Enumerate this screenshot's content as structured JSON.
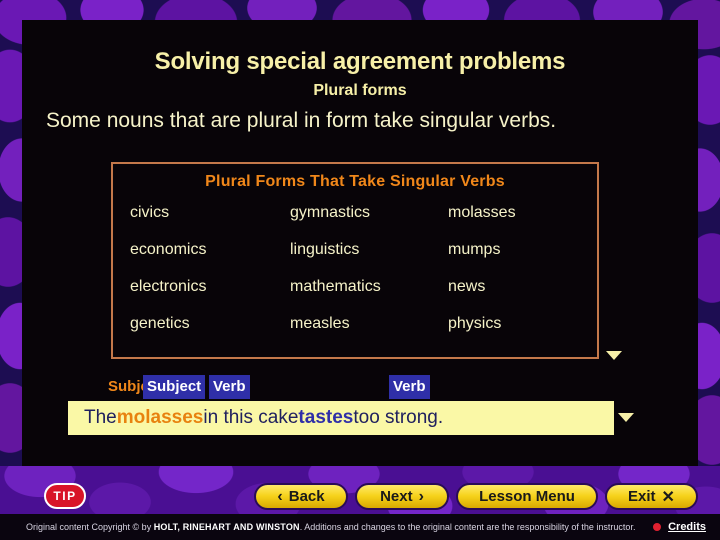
{
  "slide": {
    "title": "Solving special agreement problems",
    "subtitle": "Plural forms",
    "body_text": "Some nouns that are plural in form take singular verbs."
  },
  "table": {
    "header": "Plural Forms That Take Singular Verbs",
    "rows": [
      [
        "civics",
        "gymnastics",
        "molasses"
      ],
      [
        "economics",
        "linguistics",
        "mumps"
      ],
      [
        "electronics",
        "mathematics",
        "news"
      ],
      [
        "genetics",
        "measles",
        "physics"
      ]
    ]
  },
  "labels": {
    "subject_orange": "Subject",
    "subject_blue": "Subject",
    "verb_1": "Verb",
    "verb_2": "Verb"
  },
  "example": {
    "part_1": "The ",
    "subject_word": "molasses",
    "part_2": " in this cake ",
    "verb_word": "tastes",
    "part_3": " too strong."
  },
  "nav": {
    "tip_label": "TIP",
    "back_label": "Back",
    "back_glyph": "‹",
    "next_label": "Next",
    "next_glyph": "›",
    "lesson_menu_label": "Lesson Menu",
    "exit_label": "Exit",
    "exit_glyph": "✕"
  },
  "footer": {
    "text_before": "Original content Copyright © by ",
    "publisher": "HOLT, RINEHART AND WINSTON",
    "text_after": ". Additions and changes to the original content are the responsibility of the instructor.",
    "credits_label": "Credits"
  },
  "colors": {
    "background_indigo": "#1d0d52",
    "blob_purple": "#6a18b4",
    "panel_black": "#080408",
    "title_yellow": "#f7f0a8",
    "accent_orange": "#f0871a",
    "table_border": "#c4784a",
    "chip_blue": "#2f2fa8",
    "sentence_bar_yellow": "#faf8a6",
    "button_gold": "#f6d21a",
    "tip_red": "#d81428"
  }
}
